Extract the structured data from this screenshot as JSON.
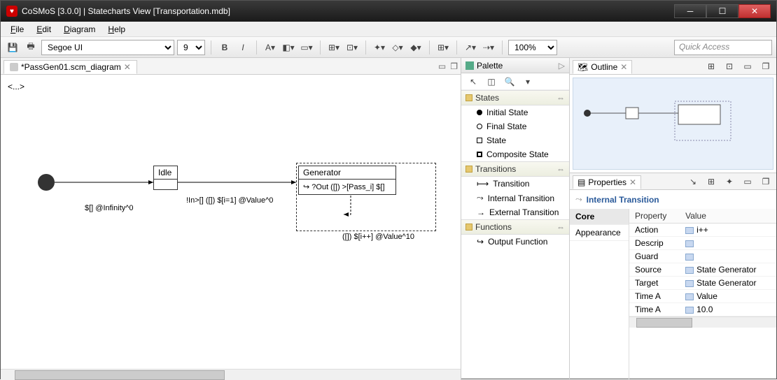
{
  "window": {
    "title": "CoSMoS [3.0.0] | Statecharts View [Transportation.mdb]"
  },
  "menu": {
    "file": "File",
    "edit": "Edit",
    "diagram": "Diagram",
    "help": "Help"
  },
  "toolbar": {
    "font_family": "Segoe UI",
    "font_size": "9",
    "zoom": "100%",
    "quick_access_placeholder": "Quick Access"
  },
  "editor": {
    "tab_label": "*PassGen01.scm_diagram",
    "ellipsis": "<...>",
    "idle_label": "Idle",
    "generator_label": "Generator",
    "generator_body": "↪ ?Out ([]) >[Pass_i] $[]",
    "edge1_label": "$[] @Infinity^0",
    "edge2_label": "!In>[] ([]) $[i=1] @Value^0",
    "self_label": "([]) $[i++] @Value^10"
  },
  "palette": {
    "title": "Palette",
    "cat_states": "States",
    "initial_state": "Initial State",
    "final_state": "Final State",
    "state": "State",
    "composite_state": "Composite State",
    "cat_transitions": "Transitions",
    "transition": "Transition",
    "internal_transition": "Internal Transition",
    "external_transition": "External Transition",
    "cat_functions": "Functions",
    "output_function": "Output Function"
  },
  "outline": {
    "title": "Outline"
  },
  "properties": {
    "title": "Properties",
    "section": "Internal Transition",
    "tab_core": "Core",
    "tab_appearance": "Appearance",
    "col_property": "Property",
    "col_value": "Value",
    "rows": [
      {
        "prop": "Action",
        "val": "i++"
      },
      {
        "prop": "Descrip",
        "val": ""
      },
      {
        "prop": "Guard",
        "val": ""
      },
      {
        "prop": "Source",
        "val": "State Generator"
      },
      {
        "prop": "Target",
        "val": "State Generator"
      },
      {
        "prop": "Time A",
        "val": "Value"
      },
      {
        "prop": "Time A",
        "val": "10.0"
      }
    ]
  }
}
